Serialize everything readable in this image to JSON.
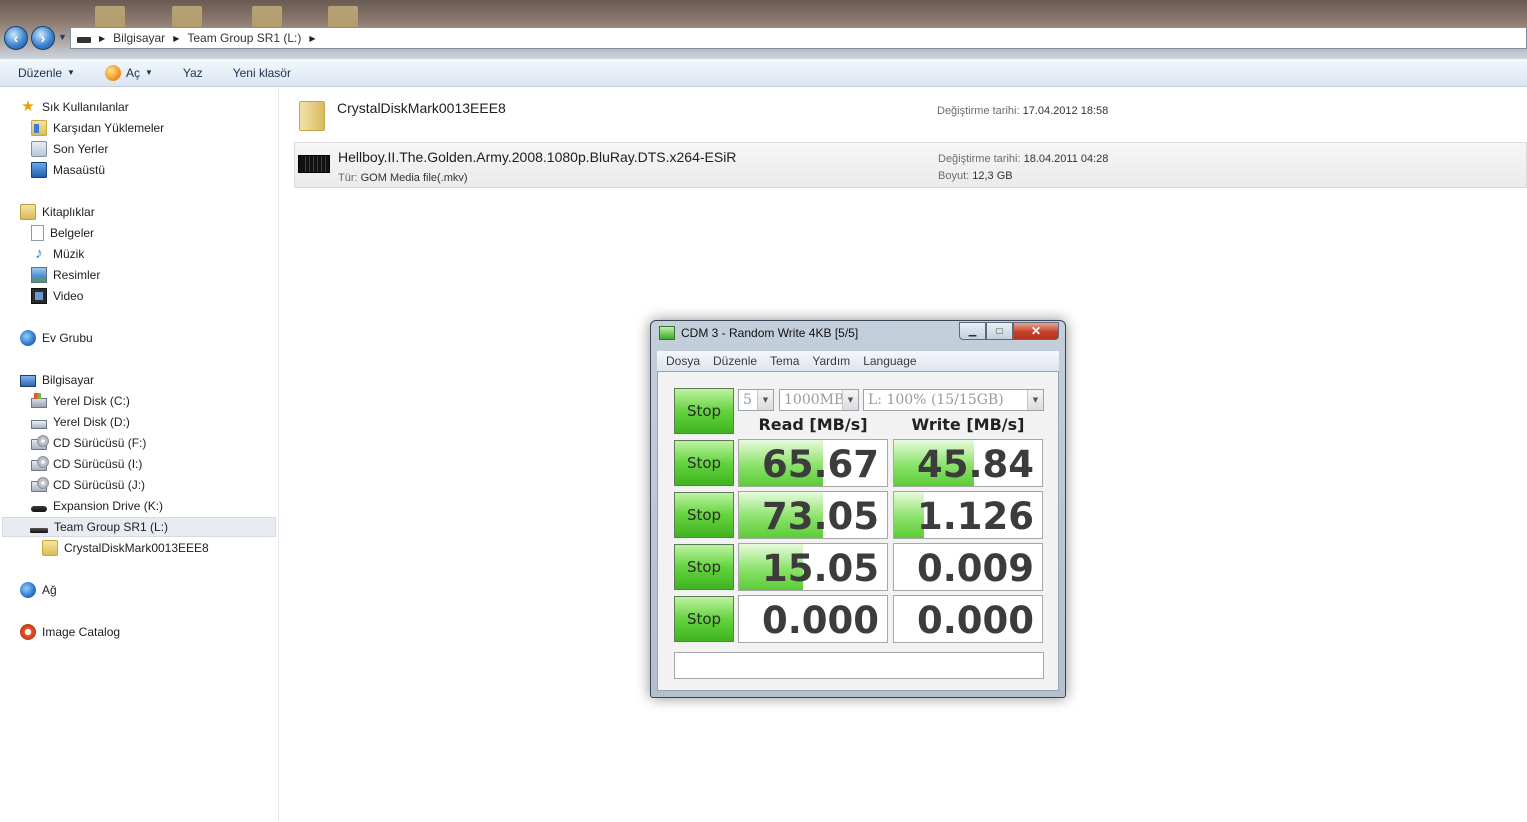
{
  "explorer": {
    "breadcrumb": [
      "Bilgisayar",
      "Team Group SR1  (L:)"
    ],
    "toolbar": {
      "organize": "Düzenle",
      "open": "Aç",
      "print": "Yaz",
      "new_folder": "Yeni klasör"
    },
    "sidebar": {
      "favorites": {
        "title": "Sık Kullanılanlar",
        "items": [
          "Karşıdan Yüklemeler",
          "Son Yerler",
          "Masaüstü"
        ]
      },
      "libraries": {
        "title": "Kitaplıklar",
        "items": [
          "Belgeler",
          "Müzik",
          "Resimler",
          "Video"
        ]
      },
      "homegroup": "Ev Grubu",
      "computer": {
        "title": "Bilgisayar",
        "items": [
          "Yerel Disk (C:)",
          "Yerel Disk (D:)",
          "CD Sürücüsü (F:)",
          "CD Sürücüsü (I:)",
          "CD Sürücüsü (J:)",
          "Expansion Drive (K:)",
          "Team Group SR1  (L:)"
        ],
        "subfolder": "CrystalDiskMark0013EEE8"
      },
      "network": "Ağ",
      "image_catalog": "Image Catalog"
    },
    "files": [
      {
        "name": "CrystalDiskMark0013EEE8",
        "modified_label": "Değiştirme tarihi:",
        "modified": "17.04.2012 18:58"
      },
      {
        "name": "Hellboy.II.The.Golden.Army.2008.1080p.BluRay.DTS.x264-ESiR",
        "type_label": "Tür:",
        "type": "GOM Media file(.mkv)",
        "modified_label": "Değiştirme tarihi:",
        "modified": "18.04.2011 04:28",
        "size_label": "Boyut:",
        "size": "12,3 GB"
      }
    ]
  },
  "cdm": {
    "title": "CDM 3 - Random Write 4KB [5/5]",
    "menu": [
      "Dosya",
      "Düzenle",
      "Tema",
      "Yardım",
      "Language"
    ],
    "controls": {
      "count": "5",
      "size": "1000MB",
      "drive": "L: 100% (15/15GB)"
    },
    "stop_label": "Stop",
    "read_header": "Read [MB/s]",
    "write_header": "Write [MB/s]",
    "rows": [
      {
        "read": "65.67",
        "write": "45.84",
        "read_fill_pct": 57,
        "write_fill_pct": 54
      },
      {
        "read": "73.05",
        "write": "1.126",
        "read_fill_pct": 57,
        "write_fill_pct": 20
      },
      {
        "read": "15.05",
        "write": "0.009",
        "read_fill_pct": 43,
        "write_fill_pct": 0
      },
      {
        "read": "0.000",
        "write": "0.000",
        "read_fill_pct": 0,
        "write_fill_pct": 0
      }
    ],
    "status": ""
  }
}
